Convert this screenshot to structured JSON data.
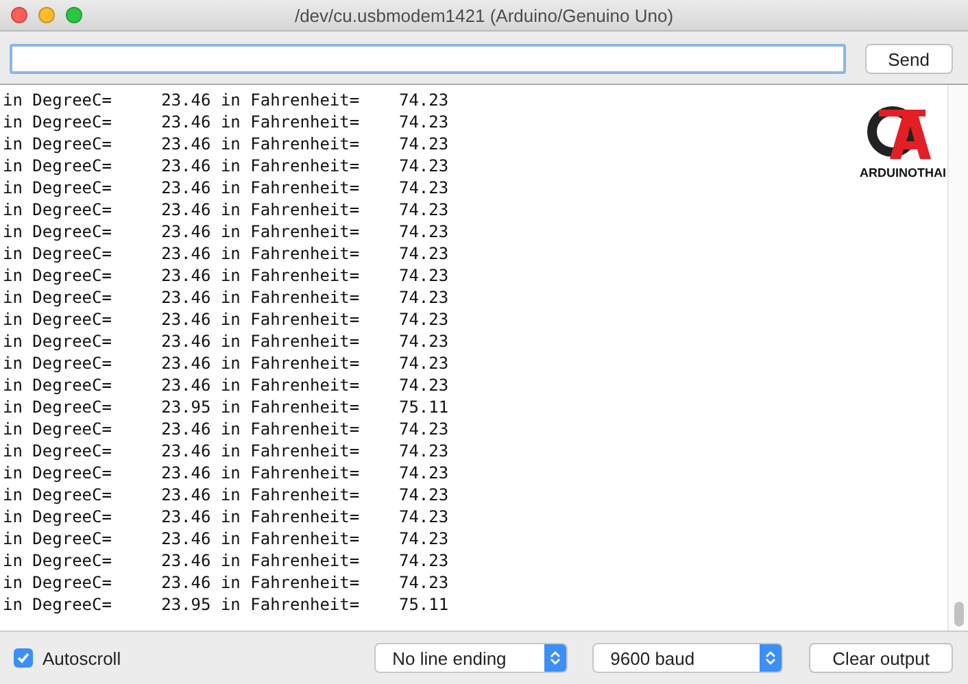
{
  "window": {
    "title": "/dev/cu.usbmodem1421 (Arduino/Genuino Uno)"
  },
  "input": {
    "focused": true
  },
  "send_button": "Send",
  "logo": {
    "text": "ARDUINOTHAI"
  },
  "output_lines": [
    "in DegreeC=     23.46 in Fahrenheit=    74.23",
    "in DegreeC=     23.46 in Fahrenheit=    74.23",
    "in DegreeC=     23.46 in Fahrenheit=    74.23",
    "in DegreeC=     23.46 in Fahrenheit=    74.23",
    "in DegreeC=     23.46 in Fahrenheit=    74.23",
    "in DegreeC=     23.46 in Fahrenheit=    74.23",
    "in DegreeC=     23.46 in Fahrenheit=    74.23",
    "in DegreeC=     23.46 in Fahrenheit=    74.23",
    "in DegreeC=     23.46 in Fahrenheit=    74.23",
    "in DegreeC=     23.46 in Fahrenheit=    74.23",
    "in DegreeC=     23.46 in Fahrenheit=    74.23",
    "in DegreeC=     23.46 in Fahrenheit=    74.23",
    "in DegreeC=     23.46 in Fahrenheit=    74.23",
    "in DegreeC=     23.46 in Fahrenheit=    74.23",
    "in DegreeC=     23.95 in Fahrenheit=    75.11",
    "in DegreeC=     23.46 in Fahrenheit=    74.23",
    "in DegreeC=     23.46 in Fahrenheit=    74.23",
    "in DegreeC=     23.46 in Fahrenheit=    74.23",
    "in DegreeC=     23.46 in Fahrenheit=    74.23",
    "in DegreeC=     23.46 in Fahrenheit=    74.23",
    "in DegreeC=     23.46 in Fahrenheit=    74.23",
    "in DegreeC=     23.46 in Fahrenheit=    74.23",
    "in DegreeC=     23.46 in Fahrenheit=    74.23",
    "in DegreeC=     23.95 in Fahrenheit=    75.11"
  ],
  "autoscroll": {
    "label": "Autoscroll",
    "checked": true
  },
  "line_ending": "No line ending",
  "baud_rate": "9600 baud",
  "clear_button": "Clear output"
}
